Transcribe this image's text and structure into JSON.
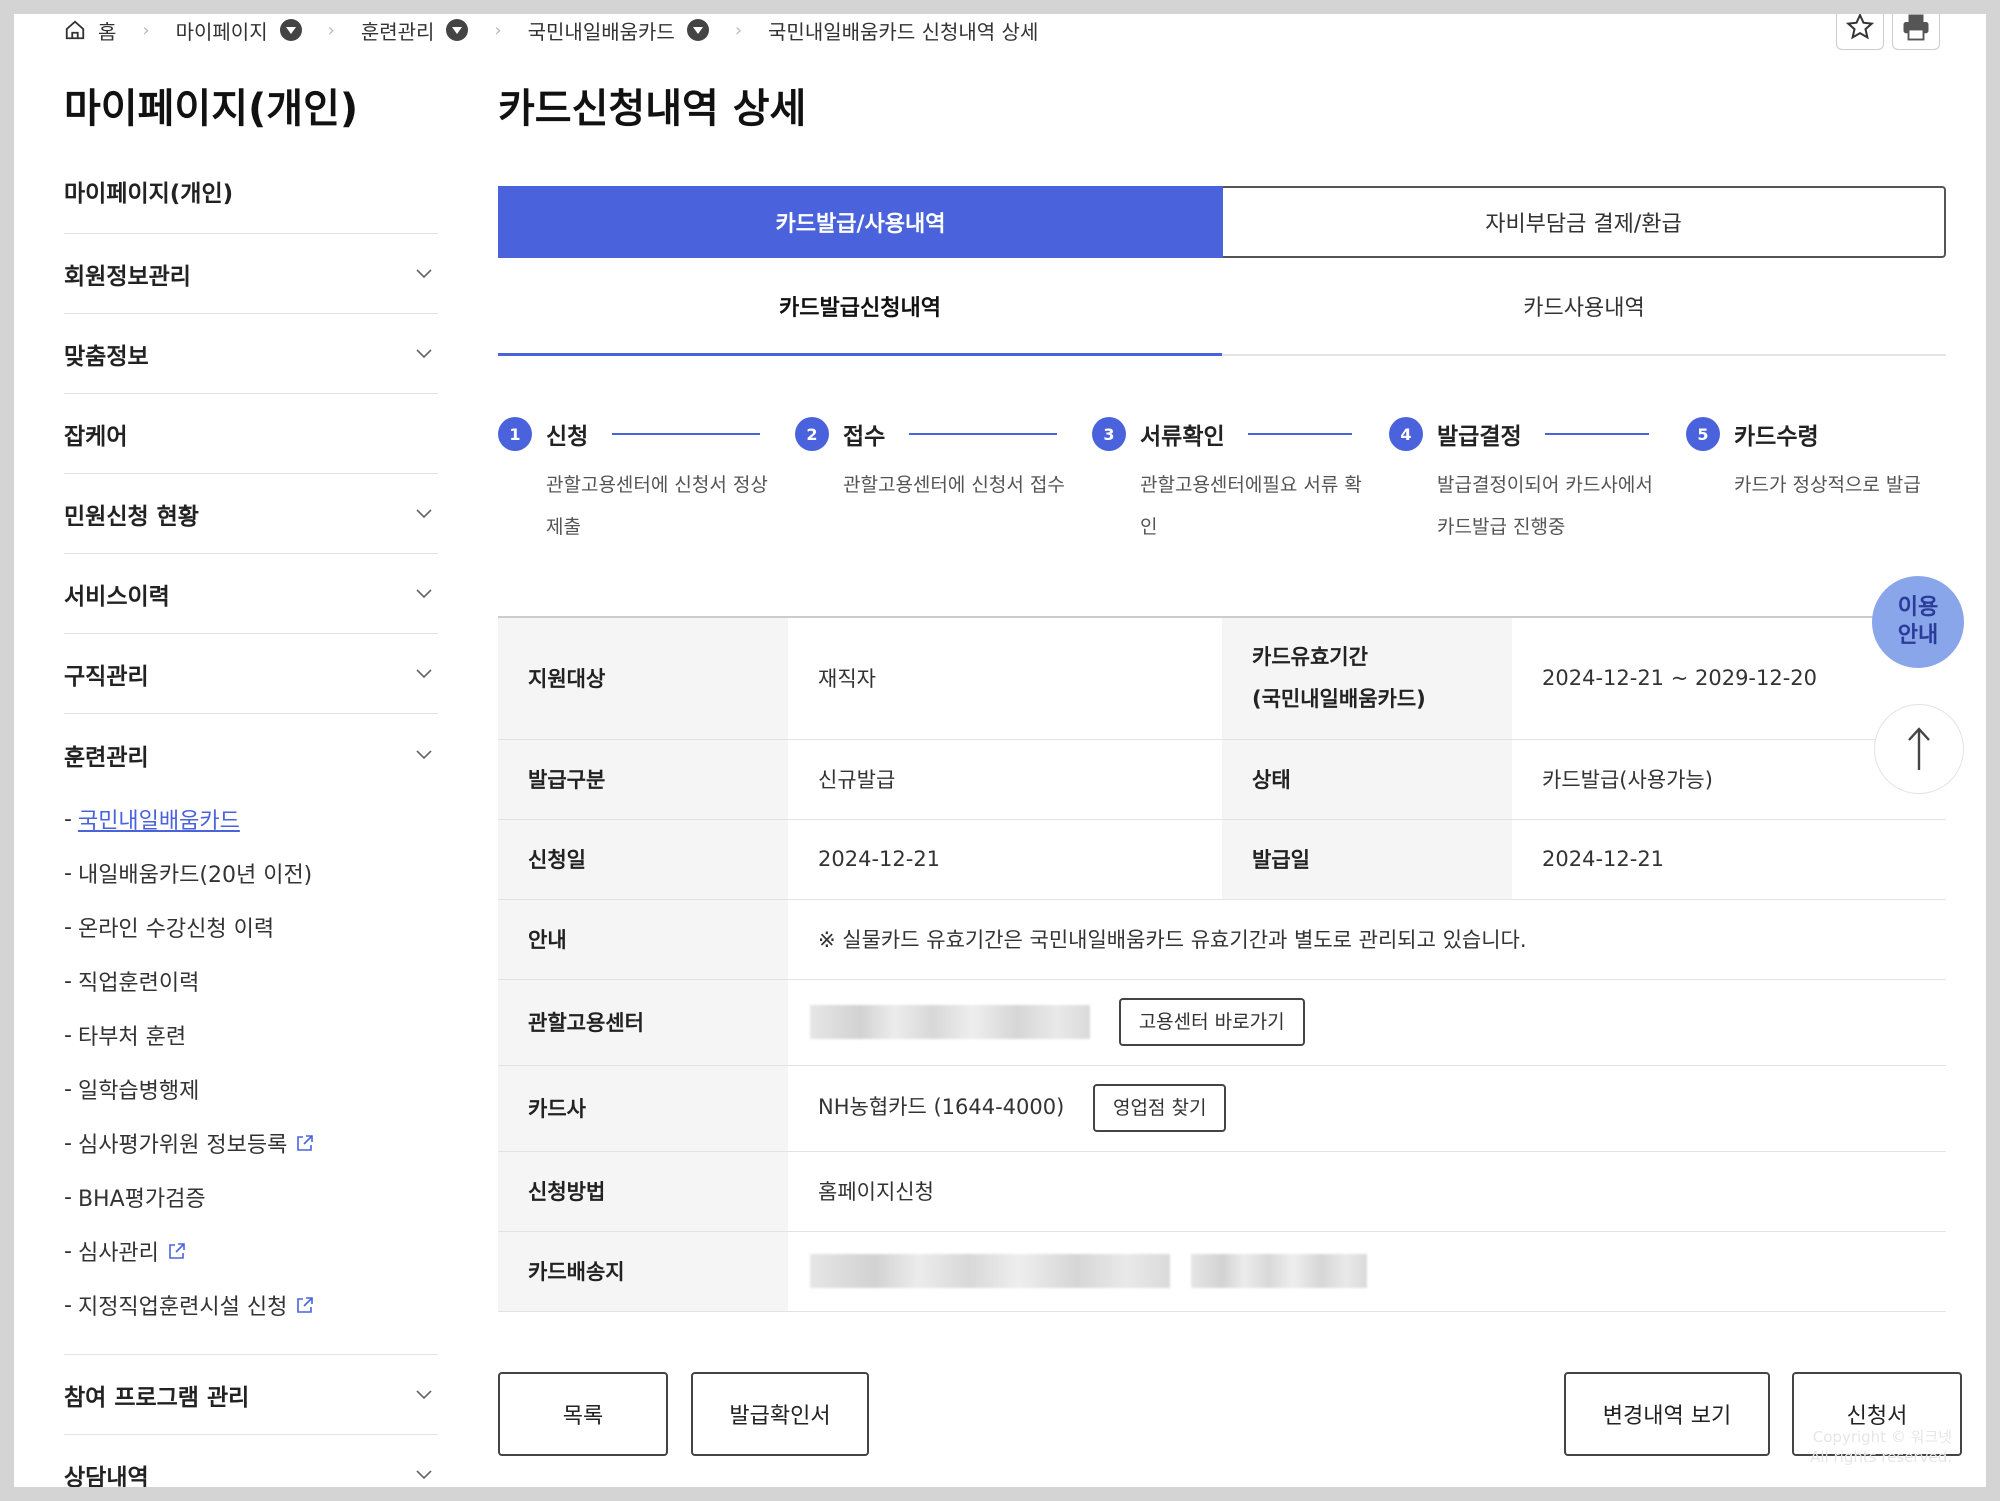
{
  "breadcrumb": {
    "home": "홈",
    "items": [
      "마이페이지",
      "훈련관리",
      "국민내일배움카드"
    ],
    "current": "국민내일배움카드 신청내역 상세"
  },
  "sidebar": {
    "title": "마이페이지(개인)",
    "items": [
      "마이페이지(개인)",
      "회원정보관리",
      "맞춤정보",
      "잡케어",
      "민원신청 현황",
      "서비스이력",
      "구직관리"
    ],
    "training": {
      "label": "훈련관리",
      "sub": [
        "국민내일배움카드",
        "내일배움카드(20년 이전)",
        "온라인 수강신청 이력",
        "직업훈련이력",
        "타부처 훈련",
        "일학습병행제",
        "심사평가위원 정보등록",
        "BHA평가검증",
        "심사관리",
        "지정직업훈련시설 신청"
      ]
    },
    "after": [
      "참여 프로그램 관리",
      "상담내역"
    ]
  },
  "main": {
    "title": "카드신청내역 상세",
    "tabs": [
      "카드발급/사용내역",
      "자비부담금 결제/환급"
    ],
    "subtabs": [
      "카드발급신청내역",
      "카드사용내역"
    ],
    "steps": [
      {
        "num": "1",
        "label": "신청",
        "desc": "관할고용센터에 신청서 정상제출"
      },
      {
        "num": "2",
        "label": "접수",
        "desc": "관할고용센터에 신청서 접수"
      },
      {
        "num": "3",
        "label": "서류확인",
        "desc": "관할고용센터에필요 서류 확인"
      },
      {
        "num": "4",
        "label": "발급결정",
        "desc": "발급결정이되어 카드사에서 카드발급 진행중"
      },
      {
        "num": "5",
        "label": "카드수령",
        "desc": "카드가 정상적으로 발급"
      }
    ],
    "table": {
      "support_label": "지원대상",
      "support_value": "재직자",
      "valid_label_1": "카드유효기간",
      "valid_label_2": "(국민내일배움카드)",
      "valid_value": "2024-12-21 ~ 2029-12-20",
      "type_label": "발급구분",
      "type_value": "신규발급",
      "status_label": "상태",
      "status_value": "카드발급(사용가능)",
      "apply_date_label": "신청일",
      "apply_date_value": "2024-12-21",
      "issue_date_label": "발급일",
      "issue_date_value": "2024-12-21",
      "notice_label": "안내",
      "notice_value": "※ 실물카드 유효기간은 국민내일배움카드 유효기간과 별도로 관리되고 있습니다.",
      "center_label": "관할고용센터",
      "center_button": "고용센터 바로가기",
      "card_company_label": "카드사",
      "card_company_value": "NH농협카드 (1644-4000)",
      "branch_button": "영업점 찾기",
      "method_label": "신청방법",
      "method_value": "홈페이지신청",
      "address_label": "카드배송지"
    },
    "buttons": {
      "list": "목록",
      "certificate": "발급확인서",
      "history": "변경내역 보기",
      "application": "신청서"
    }
  },
  "floating": {
    "guide_line1": "이용",
    "guide_line2": "안내"
  },
  "footer": {
    "copyright_1": "Copyright © 워크넷",
    "copyright_2": "All rights reserved."
  },
  "colors": {
    "accent": "#4a63dc",
    "guide": "#8aa6ea"
  }
}
